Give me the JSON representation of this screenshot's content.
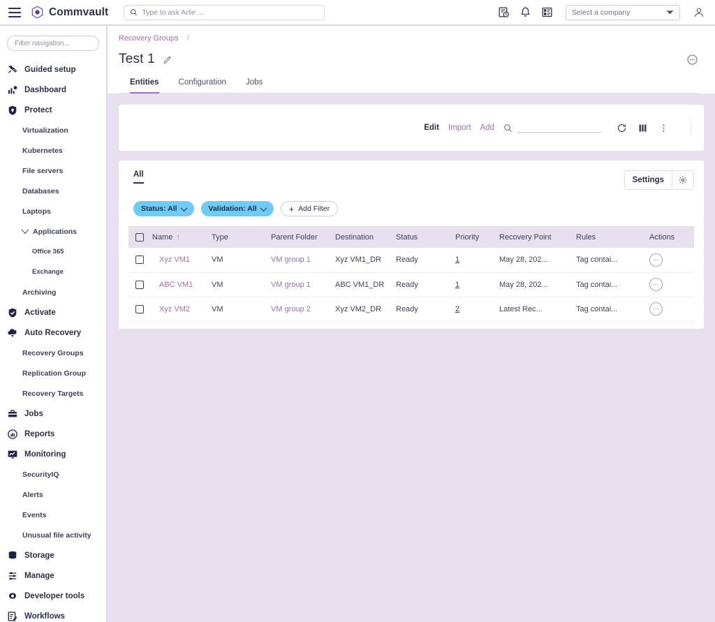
{
  "topbar": {
    "brand": "Commvault",
    "search_placeholder": "Type to ask Arlie ...",
    "icons": [
      "report-schedule-icon",
      "bell-icon",
      "task-board-icon"
    ],
    "company_select_value": "Select a company"
  },
  "sidebar": {
    "filter_placeholder": "Filter navigation...",
    "items": [
      {
        "label": "Guided setup",
        "icon": "tools-icon",
        "level": 0
      },
      {
        "label": "Dashboard",
        "icon": "bar-chart-icon",
        "level": 0
      },
      {
        "label": "Protect",
        "icon": "shield-icon",
        "level": 0
      },
      {
        "label": "Virtualization",
        "level": 1
      },
      {
        "label": "Kubernetes",
        "level": 1
      },
      {
        "label": "File servers",
        "level": 1
      },
      {
        "label": "Databases",
        "level": 1
      },
      {
        "label": "Laptops",
        "level": 1
      },
      {
        "label": "Applications",
        "level": 1,
        "expandable": true
      },
      {
        "label": "Office 365",
        "level": 2
      },
      {
        "label": "Exchange",
        "level": 2
      },
      {
        "label": "Archiving",
        "level": 1
      },
      {
        "label": "Activate",
        "icon": "shield-check-icon",
        "level": 0
      },
      {
        "label": "Auto Recovery",
        "icon": "auto-recovery-icon",
        "level": 0
      },
      {
        "label": "Recovery Groups",
        "level": 1
      },
      {
        "label": "Replication Group",
        "level": 1
      },
      {
        "label": "Recovery Targets",
        "level": 1
      },
      {
        "label": "Jobs",
        "icon": "briefcase-icon",
        "level": 0
      },
      {
        "label": "Reports",
        "icon": "report-icon",
        "level": 0
      },
      {
        "label": "Monitoring",
        "icon": "monitor-icon",
        "level": 0
      },
      {
        "label": "SecurityIQ",
        "level": 1
      },
      {
        "label": "Alerts",
        "level": 1
      },
      {
        "label": "Events",
        "level": 1
      },
      {
        "label": "Unusual file activity",
        "level": 1
      },
      {
        "label": "Storage",
        "icon": "database-icon",
        "level": 0
      },
      {
        "label": "Manage",
        "icon": "sliders-icon",
        "level": 0
      },
      {
        "label": "Developer tools",
        "icon": "gear-code-icon",
        "level": 0
      },
      {
        "label": "Workflows",
        "icon": "workflow-icon",
        "level": 0
      }
    ]
  },
  "page": {
    "breadcrumb": "Recovery Groups",
    "breadcrumb_separator": "/",
    "title": "Test 1",
    "tabs": [
      {
        "label": "Entities",
        "active": true
      },
      {
        "label": "Configuration",
        "active": false
      },
      {
        "label": "Jobs",
        "active": false
      }
    ]
  },
  "toolbar": {
    "edit_label": "Edit",
    "import_label": "Import",
    "add_label": "Add",
    "search_value": ""
  },
  "table_panel": {
    "all_tab_label": "All",
    "settings_label": "Settings",
    "filters": [
      {
        "label": "Status: All",
        "type": "dropdown"
      },
      {
        "label": "Validation: All",
        "type": "dropdown"
      },
      {
        "label": "Add Filter",
        "type": "add"
      }
    ],
    "columns": [
      "Name",
      "Type",
      "Parent Folder",
      "Destination",
      "Status",
      "Priority",
      "Recovery Point",
      "Rules",
      "Actions"
    ],
    "sort_column": "Name",
    "sort_direction": "↑",
    "rows": [
      {
        "name": "Xyz VM1",
        "type": "VM",
        "parent_folder": "VM group 1",
        "destination": "Xyz VM1_DR",
        "status": "Ready",
        "priority": "1",
        "recovery_point": "May 28, 202...",
        "rules": "Tag contai..."
      },
      {
        "name": "ABC VM1",
        "type": "VM",
        "parent_folder": "VM group 1",
        "destination": "ABC VM1_DR",
        "status": "Ready",
        "priority": "1",
        "recovery_point": "May 28, 202...",
        "rules": "Tag contai..."
      },
      {
        "name": "Xyz VM2",
        "type": "VM",
        "parent_folder": "VM group 2",
        "destination": "Xyz VM2_DR",
        "status": "Ready",
        "priority": "2",
        "recovery_point": "Latest Rec...",
        "rules": "Tag contai..."
      }
    ]
  },
  "colors": {
    "accent_purple": "#9b6fc0",
    "link_pink": "#b06bb0",
    "navy": "#2b2f4a",
    "page_bg": "#e9e0ef",
    "chip_blue": "#6ecbf5"
  }
}
